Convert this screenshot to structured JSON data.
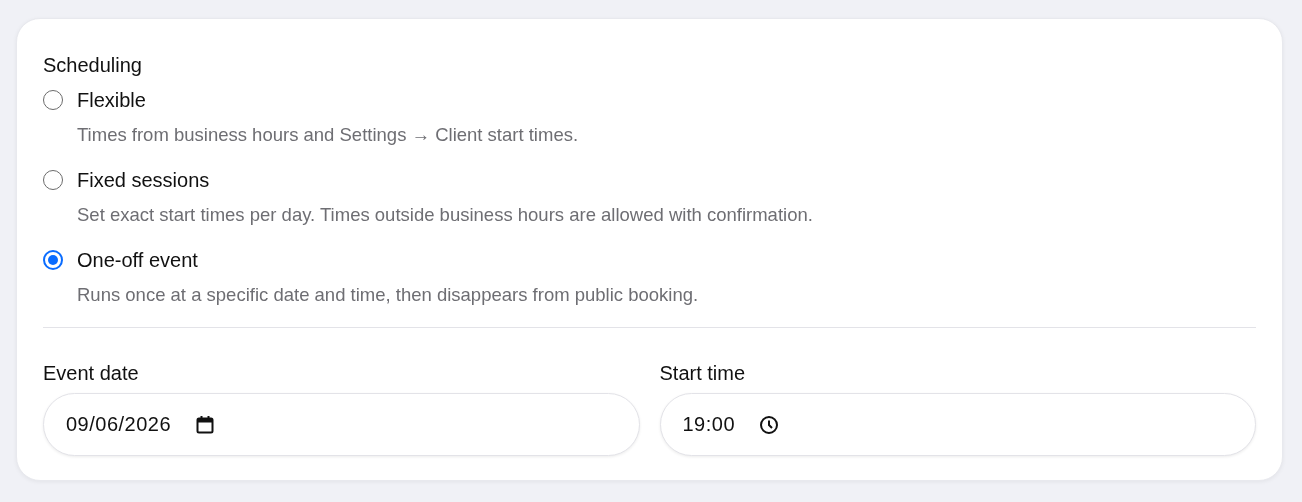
{
  "heading": "Scheduling",
  "options": [
    {
      "label": "Flexible",
      "description": "Times from business hours and Settings → Client start times.",
      "selected": false
    },
    {
      "label": "Fixed sessions",
      "description": "Set exact start times per day. Times outside business hours are allowed with confirmation.",
      "selected": false
    },
    {
      "label": "One-off event",
      "description": "Runs once at a specific date and time, then disappears from public booking.",
      "selected": true
    }
  ],
  "fields": [
    {
      "label": "Event date",
      "value": "09/06/2026",
      "kind": "date"
    },
    {
      "label": "Start time",
      "value": "19:00",
      "kind": "time"
    }
  ]
}
